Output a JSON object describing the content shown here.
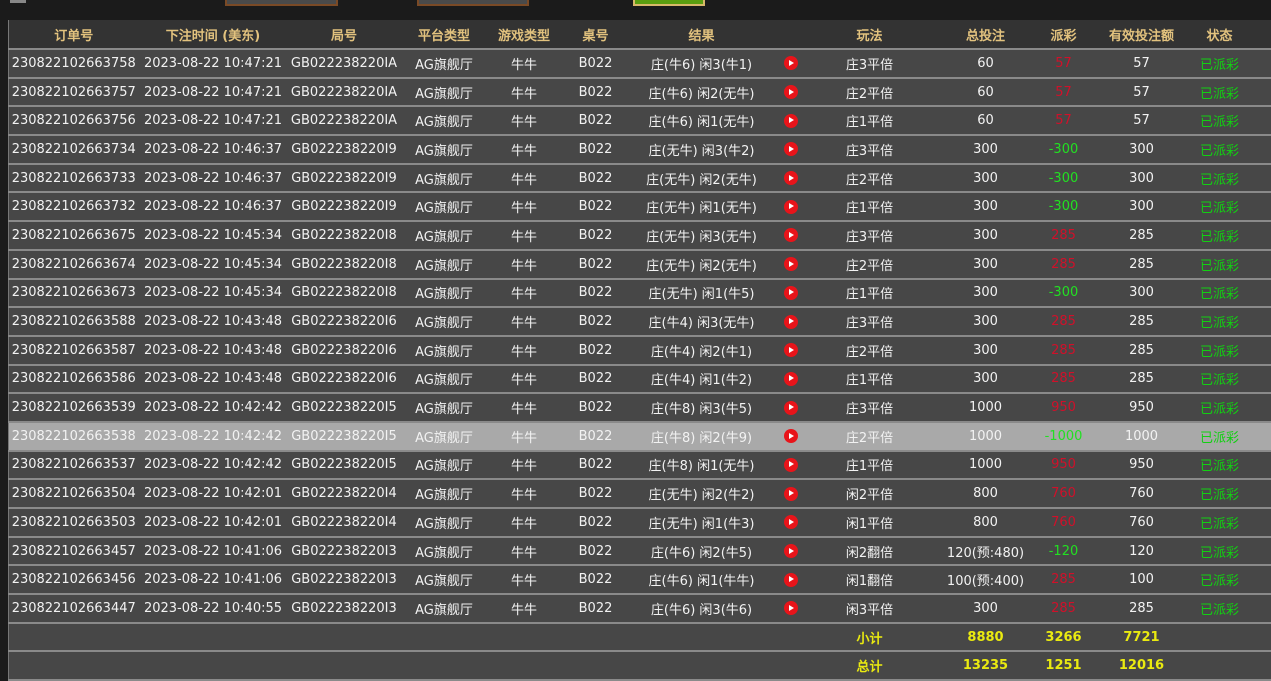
{
  "columns": [
    "订单号",
    "下注时间 (美东)",
    "局号",
    "平台类型",
    "游戏类型",
    "桌号",
    "结果",
    "",
    "玩法",
    "总投注",
    "派彩",
    "有效投注额",
    "状态"
  ],
  "rows": [
    [
      "230822102663758",
      "2023-08-22 10:47:21",
      "GB022238220IA",
      "AG旗舰厅",
      "牛牛",
      "B022",
      "庄(牛6) 闲3(牛1)",
      "庄3平倍",
      "60",
      "57",
      "57",
      "已派彩"
    ],
    [
      "230822102663757",
      "2023-08-22 10:47:21",
      "GB022238220IA",
      "AG旗舰厅",
      "牛牛",
      "B022",
      "庄(牛6) 闲2(无牛)",
      "庄2平倍",
      "60",
      "57",
      "57",
      "已派彩"
    ],
    [
      "230822102663756",
      "2023-08-22 10:47:21",
      "GB022238220IA",
      "AG旗舰厅",
      "牛牛",
      "B022",
      "庄(牛6) 闲1(无牛)",
      "庄1平倍",
      "60",
      "57",
      "57",
      "已派彩"
    ],
    [
      "230822102663734",
      "2023-08-22 10:46:37",
      "GB022238220I9",
      "AG旗舰厅",
      "牛牛",
      "B022",
      "庄(无牛) 闲3(牛2)",
      "庄3平倍",
      "300",
      "-300",
      "300",
      "已派彩"
    ],
    [
      "230822102663733",
      "2023-08-22 10:46:37",
      "GB022238220I9",
      "AG旗舰厅",
      "牛牛",
      "B022",
      "庄(无牛) 闲2(无牛)",
      "庄2平倍",
      "300",
      "-300",
      "300",
      "已派彩"
    ],
    [
      "230822102663732",
      "2023-08-22 10:46:37",
      "GB022238220I9",
      "AG旗舰厅",
      "牛牛",
      "B022",
      "庄(无牛) 闲1(无牛)",
      "庄1平倍",
      "300",
      "-300",
      "300",
      "已派彩"
    ],
    [
      "230822102663675",
      "2023-08-22 10:45:34",
      "GB022238220I8",
      "AG旗舰厅",
      "牛牛",
      "B022",
      "庄(无牛) 闲3(无牛)",
      "庄3平倍",
      "300",
      "285",
      "285",
      "已派彩"
    ],
    [
      "230822102663674",
      "2023-08-22 10:45:34",
      "GB022238220I8",
      "AG旗舰厅",
      "牛牛",
      "B022",
      "庄(无牛) 闲2(无牛)",
      "庄2平倍",
      "300",
      "285",
      "285",
      "已派彩"
    ],
    [
      "230822102663673",
      "2023-08-22 10:45:34",
      "GB022238220I8",
      "AG旗舰厅",
      "牛牛",
      "B022",
      "庄(无牛) 闲1(牛5)",
      "庄1平倍",
      "300",
      "-300",
      "300",
      "已派彩"
    ],
    [
      "230822102663588",
      "2023-08-22 10:43:48",
      "GB022238220I6",
      "AG旗舰厅",
      "牛牛",
      "B022",
      "庄(牛4) 闲3(无牛)",
      "庄3平倍",
      "300",
      "285",
      "285",
      "已派彩"
    ],
    [
      "230822102663587",
      "2023-08-22 10:43:48",
      "GB022238220I6",
      "AG旗舰厅",
      "牛牛",
      "B022",
      "庄(牛4) 闲2(牛1)",
      "庄2平倍",
      "300",
      "285",
      "285",
      "已派彩"
    ],
    [
      "230822102663586",
      "2023-08-22 10:43:48",
      "GB022238220I6",
      "AG旗舰厅",
      "牛牛",
      "B022",
      "庄(牛4) 闲1(牛2)",
      "庄1平倍",
      "300",
      "285",
      "285",
      "已派彩"
    ],
    [
      "230822102663539",
      "2023-08-22 10:42:42",
      "GB022238220I5",
      "AG旗舰厅",
      "牛牛",
      "B022",
      "庄(牛8) 闲3(牛5)",
      "庄3平倍",
      "1000",
      "950",
      "950",
      "已派彩"
    ],
    [
      "230822102663538",
      "2023-08-22 10:42:42",
      "GB022238220I5",
      "AG旗舰厅",
      "牛牛",
      "B022",
      "庄(牛8) 闲2(牛9)",
      "庄2平倍",
      "1000",
      "-1000",
      "1000",
      "已派彩"
    ],
    [
      "230822102663537",
      "2023-08-22 10:42:42",
      "GB022238220I5",
      "AG旗舰厅",
      "牛牛",
      "B022",
      "庄(牛8) 闲1(无牛)",
      "庄1平倍",
      "1000",
      "950",
      "950",
      "已派彩"
    ],
    [
      "230822102663504",
      "2023-08-22 10:42:01",
      "GB022238220I4",
      "AG旗舰厅",
      "牛牛",
      "B022",
      "庄(无牛) 闲2(牛2)",
      "闲2平倍",
      "800",
      "760",
      "760",
      "已派彩"
    ],
    [
      "230822102663503",
      "2023-08-22 10:42:01",
      "GB022238220I4",
      "AG旗舰厅",
      "牛牛",
      "B022",
      "庄(无牛) 闲1(牛3)",
      "闲1平倍",
      "800",
      "760",
      "760",
      "已派彩"
    ],
    [
      "230822102663457",
      "2023-08-22 10:41:06",
      "GB022238220I3",
      "AG旗舰厅",
      "牛牛",
      "B022",
      "庄(牛6) 闲2(牛5)",
      "闲2翻倍",
      "120(预:480)",
      "-120",
      "120",
      "已派彩"
    ],
    [
      "230822102663456",
      "2023-08-22 10:41:06",
      "GB022238220I3",
      "AG旗舰厅",
      "牛牛",
      "B022",
      "庄(牛6) 闲1(牛牛)",
      "闲1翻倍",
      "100(预:400)",
      "285",
      "100",
      "已派彩"
    ],
    [
      "230822102663447",
      "2023-08-22 10:40:55",
      "GB022238220I3",
      "AG旗舰厅",
      "牛牛",
      "B022",
      "庄(牛6) 闲3(牛6)",
      "闲3平倍",
      "300",
      "285",
      "285",
      "已派彩"
    ]
  ],
  "highlighted_row": 13,
  "subtotal": {
    "label": "小计",
    "total_bet": "8880",
    "payout": "3266",
    "valid_bet": "7721"
  },
  "total": {
    "label": "总计",
    "total_bet": "13235",
    "payout": "1251",
    "valid_bet": "12016"
  },
  "colors": {
    "header_text": "#e2c27e",
    "loss": "#d0102a",
    "win": "#22e022",
    "status": "#12d012",
    "summary": "#eaea10"
  }
}
